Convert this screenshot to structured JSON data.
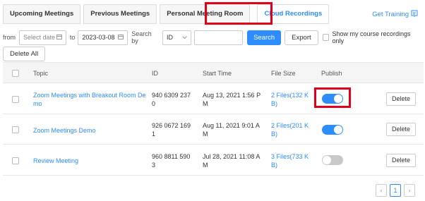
{
  "tabs": [
    {
      "label": "Upcoming Meetings",
      "active": false
    },
    {
      "label": "Previous Meetings",
      "active": false
    },
    {
      "label": "Personal Meeting Room",
      "active": false
    },
    {
      "label": "Cloud Recordings",
      "active": true
    }
  ],
  "get_training": {
    "label": "Get Training",
    "icon": "training-icon"
  },
  "filter": {
    "from_label": "from",
    "from_placeholder": "Select date",
    "to_label": "to",
    "to_value": "2023-03-08",
    "search_by_label": "Search by",
    "search_by_value": "ID",
    "search_button": "Search",
    "export_button": "Export",
    "show_course_label": "Show my course recordings only"
  },
  "delete_all": "Delete All",
  "table": {
    "headers": {
      "topic": "Topic",
      "id": "ID",
      "start_time": "Start Time",
      "file_size": "File Size",
      "publish": "Publish"
    },
    "rows": [
      {
        "topic_line1": "Zoom Meetings with Breakout Room De",
        "topic_line2": "mo",
        "id_line1": "940 6309 237",
        "id_line2": "0",
        "time_line1": "Aug 13, 2021 1:56 P",
        "time_line2": "M",
        "size_line1": "2 Files(132 K",
        "size_line2": "B)",
        "published": true,
        "delete": "Delete"
      },
      {
        "topic_line1": "Zoom Meetings Demo",
        "topic_line2": "",
        "id_line1": "926 0672 169",
        "id_line2": "1",
        "time_line1": "Aug 11, 2021 9:01 A",
        "time_line2": "M",
        "size_line1": "2 Files(201 K",
        "size_line2": "B)",
        "published": true,
        "delete": "Delete"
      },
      {
        "topic_line1": "Review Meeting",
        "topic_line2": "",
        "id_line1": "960 8811 590",
        "id_line2": "3",
        "time_line1": "Jul 28, 2021 11:08 A",
        "time_line2": "M",
        "size_line1": "3 Files(733 K",
        "size_line2": "B)",
        "published": false,
        "delete": "Delete"
      }
    ]
  },
  "pagination": {
    "prev": "‹",
    "current": "1",
    "next": "›"
  },
  "colors": {
    "accent": "#2d8cff",
    "highlight": "#e0001a"
  }
}
